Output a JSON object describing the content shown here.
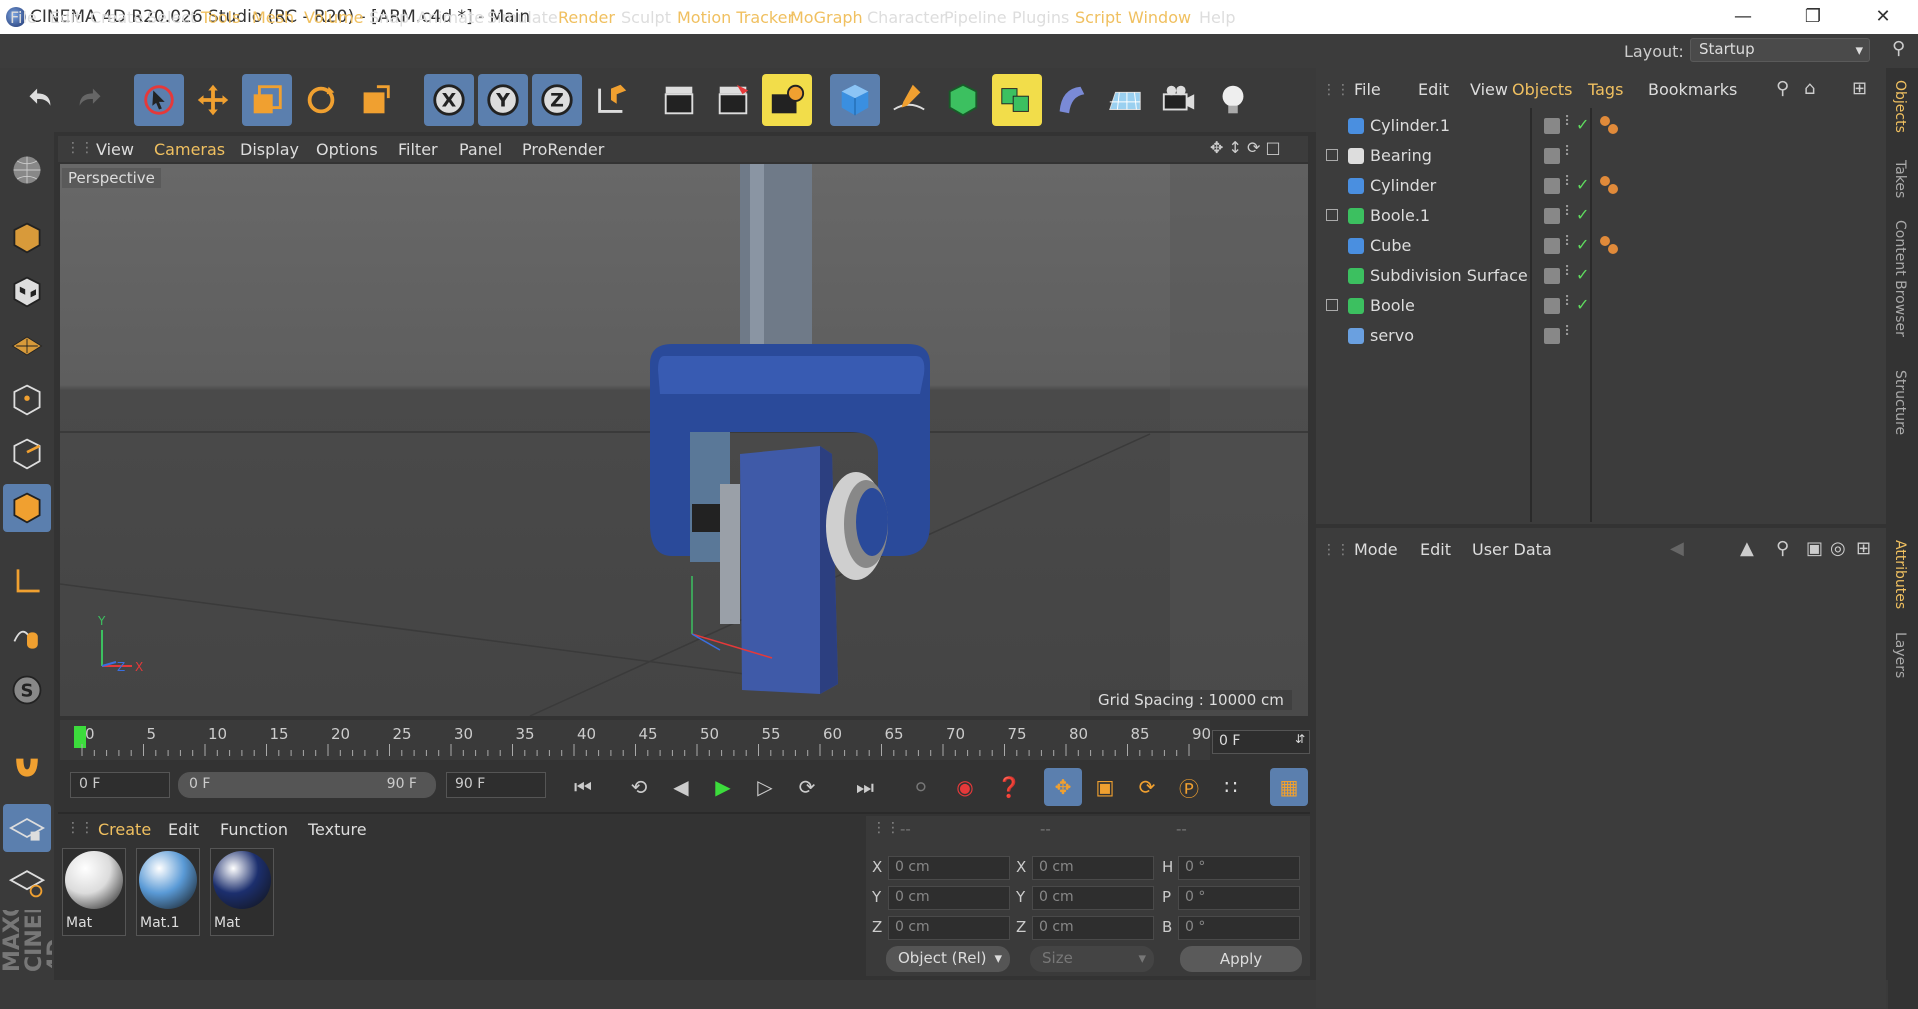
{
  "window": {
    "title": "CINEMA 4D R20.026 Studio (RC - R20) - [ARM.c4d *] - Main"
  },
  "menubar": {
    "items": [
      "File",
      "Edit",
      "Create",
      "Select",
      "Tools",
      "Mesh",
      "Volume",
      "Snap",
      "Animate",
      "Simulate",
      "Render",
      "Sculpt",
      "Motion Tracker",
      "MoGraph",
      "Character",
      "Pipeline",
      "Plugins",
      "Script",
      "Window",
      "Help"
    ],
    "layout_label": "Layout:",
    "layout_value": "Startup"
  },
  "viewport": {
    "menu": [
      "View",
      "Cameras",
      "Display",
      "Options",
      "Filter",
      "Panel",
      "ProRender"
    ],
    "label": "Perspective",
    "grid_spacing": "Grid Spacing : 10000 cm",
    "axis_y": "Y",
    "axis_z": "Z",
    "axis_x": "X"
  },
  "timeline": {
    "ticks": [
      "0",
      "5",
      "10",
      "15",
      "20",
      "25",
      "30",
      "35",
      "40",
      "45",
      "50",
      "55",
      "60",
      "65",
      "70",
      "75",
      "80",
      "85",
      "90"
    ],
    "current_frame": "0 F",
    "start_field": "0 F",
    "range_start": "0 F",
    "range_end": "90 F",
    "end_field": "90 F"
  },
  "materials": {
    "menu": [
      "Create",
      "Edit",
      "Function",
      "Texture"
    ],
    "items": [
      {
        "name": "Mat",
        "color": "#dcdcdc"
      },
      {
        "name": "Mat.1",
        "color": "#5a9ad6"
      },
      {
        "name": "Mat",
        "color": "#1c2f6e"
      }
    ]
  },
  "coords": {
    "headers": [
      "--",
      "--",
      "--"
    ],
    "rows": [
      {
        "l1": "X",
        "v1": "0 cm",
        "l2": "X",
        "v2": "0 cm",
        "l3": "H",
        "v3": "0 °"
      },
      {
        "l1": "Y",
        "v1": "0 cm",
        "l2": "Y",
        "v2": "0 cm",
        "l3": "P",
        "v3": "0 °"
      },
      {
        "l1": "Z",
        "v1": "0 cm",
        "l2": "Z",
        "v2": "0 cm",
        "l3": "B",
        "v3": "0 °"
      }
    ],
    "mode_select": "Object (Rel)",
    "size_select": "Size",
    "apply_label": "Apply"
  },
  "objects": {
    "menu": [
      "File",
      "Edit",
      "View",
      "Objects",
      "Tags",
      "Bookmarks"
    ],
    "items": [
      {
        "name": "Cylinder.1",
        "expandable": false,
        "check": true,
        "tag": true
      },
      {
        "name": "Bearing",
        "expandable": true,
        "check": false,
        "tag": false
      },
      {
        "name": "Cylinder",
        "expandable": false,
        "check": true,
        "tag": true
      },
      {
        "name": "Boole.1",
        "expandable": true,
        "check": true,
        "tag": false
      },
      {
        "name": "Cube",
        "expandable": false,
        "check": true,
        "tag": true
      },
      {
        "name": "Subdivision Surface",
        "expandable": false,
        "check": true,
        "tag": false
      },
      {
        "name": "Boole",
        "expandable": true,
        "check": true,
        "tag": false
      },
      {
        "name": "servo",
        "expandable": false,
        "check": false,
        "tag": false
      }
    ]
  },
  "attributes": {
    "menu": [
      "Mode",
      "Edit",
      "User Data"
    ]
  },
  "right_tabs": {
    "top": [
      "Objects",
      "Takes",
      "Content Browser",
      "Structure"
    ],
    "bottom": [
      "Attributes",
      "Layers"
    ]
  },
  "branding": "MAXON CINEMA 4D",
  "colors": {
    "accent": "#f0c060",
    "active_button": "#5b7fae",
    "highlight_button": "#f2dd4a"
  }
}
